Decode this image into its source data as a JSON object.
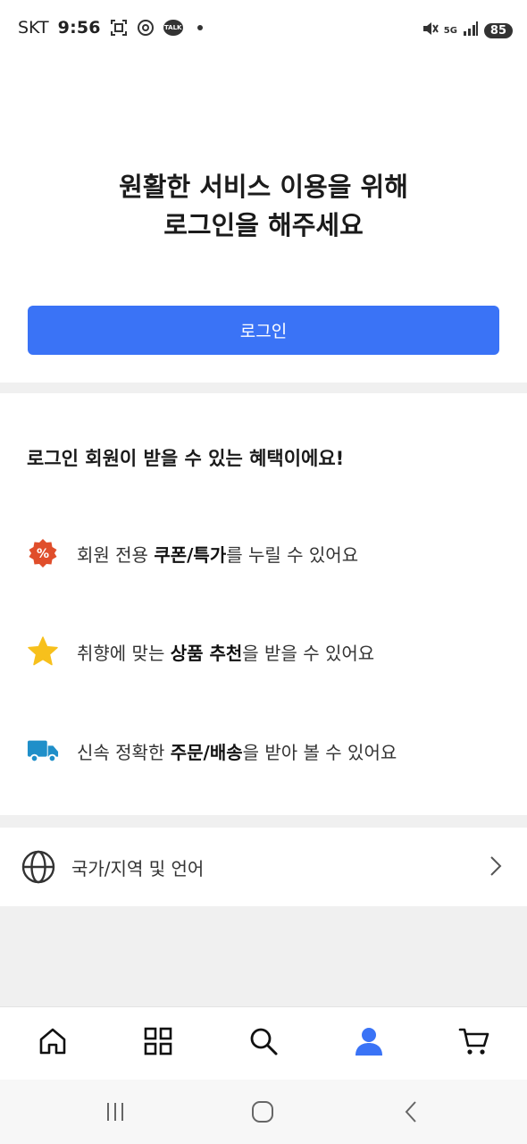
{
  "status_bar": {
    "carrier": "SKT",
    "time": "9:56",
    "talk_label": "TALK",
    "network": "5G",
    "battery": "85"
  },
  "hero": {
    "line1": "원활한 서비스 이용을 위해",
    "line2": "로그인을 해주세요"
  },
  "login_button": "로그인",
  "benefits": {
    "title": "로그인 회원이 받을 수 있는 혜택이에요!",
    "items": [
      {
        "icon": "percent-badge-icon",
        "pre": "회원 전용 ",
        "bold": "쿠폰/특가",
        "post": "를 누릴 수 있어요"
      },
      {
        "icon": "star-icon",
        "pre": "취향에 맞는 ",
        "bold": "상품 추천",
        "post": "을 받을 수 있어요"
      },
      {
        "icon": "delivery-truck-icon",
        "pre": "신속 정확한 ",
        "bold": "주문/배송",
        "post": "을 받아 볼 수 있어요"
      }
    ]
  },
  "region_row": {
    "label": "국가/지역 및 언어",
    "icon": "globe-icon"
  },
  "tab_bar": {
    "active": "account",
    "tabs": [
      "home",
      "categories",
      "search",
      "account",
      "cart"
    ]
  },
  "colors": {
    "primary": "#3a73f6",
    "divider": "#f0f0f0",
    "percent_badge": "#e04e2b",
    "star": "#f7c01c",
    "truck": "#1f8fc9"
  }
}
